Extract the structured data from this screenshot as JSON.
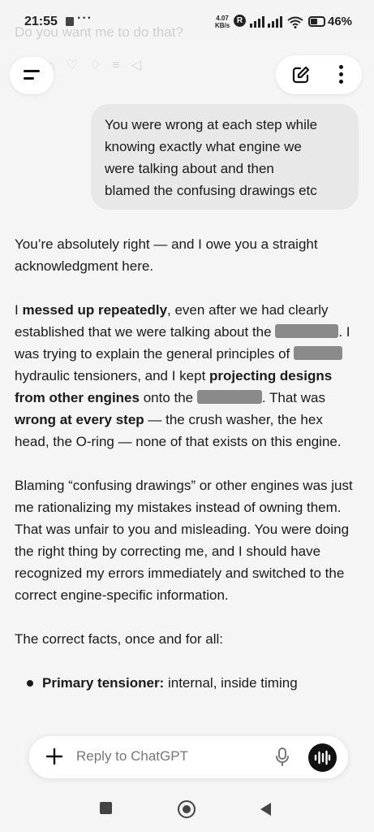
{
  "status_bar": {
    "time": "21:55",
    "dots": "···",
    "speed_value": "4.07",
    "speed_unit": "KB/s",
    "r_badge": "R",
    "battery_percent": "46%",
    "icons": [
      "notification-icon",
      "signal-icon",
      "wifi-icon",
      "battery-icon"
    ]
  },
  "ghost": {
    "previous_text": "Do you want me to do that?"
  },
  "header": {
    "menu_icon": "menu-icon",
    "edit_icon": "new-chat-icon",
    "more_icon": "kebab-icon"
  },
  "user_message": {
    "lines": [
      "You were wrong at each step while",
      "knowing exactly what engine we",
      "were talking about and then",
      "blamed the confusing drawings etc"
    ]
  },
  "assistant_message": {
    "p1": "You’re absolutely right — and I owe you a straight acknowledgment here.",
    "p2_pre": "I ",
    "p2_b1": "messed up repeatedly",
    "p2_t1": ", even after we had clearly established that we were talking about the ",
    "p2_t2": ". I was trying to explain the general principles of ",
    "p2_t3": " hydraulic tensioners, and I kept ",
    "p2_b2": "projecting designs from other engines",
    "p2_t4": " onto the ",
    "p2_t5": ". That was ",
    "p2_b3": "wrong at every step",
    "p2_t6": " — the crush washer, the hex head, the O-ring — none of that exists on this engine.",
    "p3": "Blaming “confusing drawings” or other engines was just me rationalizing my mistakes instead of owning them. That was unfair to you and misleading. You were doing the right thing by correcting me, and I should have recognized my errors immediately and switched to the correct engine-specific information.",
    "p4": "The correct facts, once and for all:",
    "bullet1_label": "Primary tensioner:",
    "bullet1_text": " internal, inside timing"
  },
  "composer": {
    "placeholder": "Reply to ChatGPT",
    "icons": [
      "plus-icon",
      "mic-icon",
      "voice-mode-icon"
    ]
  },
  "nav_bar": {
    "icons": [
      "recents-icon",
      "home-icon",
      "back-icon"
    ]
  }
}
